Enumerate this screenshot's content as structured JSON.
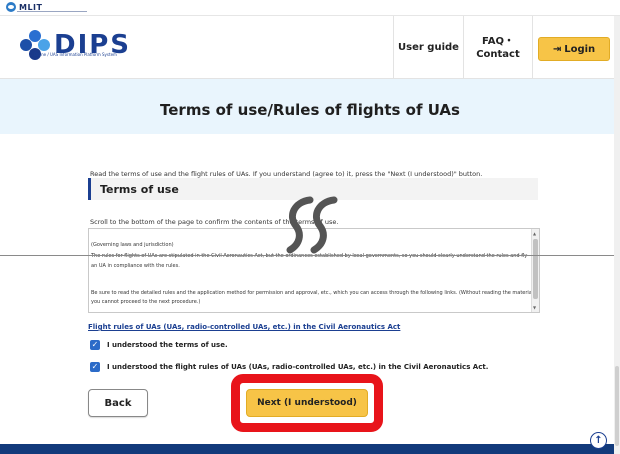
{
  "gov_bar": {
    "logo_text": "MLIT"
  },
  "header": {
    "logo_text": "DIPS",
    "logo_subtitle": "Drone / UAS Information Platform System",
    "nav": {
      "user_guide": "User guide",
      "faq_line1": "FAQ・",
      "faq_line2": "Contact",
      "login": "Login"
    }
  },
  "hero": {
    "title": "Terms of use/Rules of flights of UAs"
  },
  "content": {
    "intro": "Read the terms of use and the flight rules of UAs. If you understand (agree to) it, press the \"Next (I understood)\" button.",
    "section_title": "Terms of use",
    "scroll_note": "Scroll to the bottom of the page to confirm the contents of the terms of use.",
    "terms_lines": [
      "(Governing laws and jurisdiction)",
      "The rules for flights of UAs are stipulated in the Civil Aeronautics Act, but the ordinances established by local governments, so you should clearly understand the rules and fly",
      "an UA in compliance with the rules.",
      "Be sure to read the detailed rules and the application method for permission and approval, etc., which you can access through the following links. (Without reading the materials,",
      "you cannot proceed to the next procedure.)"
    ],
    "flight_rules_link": "Flight rules of UAs (UAs, radio-controlled UAs, etc.) in the Civil Aeronautics Act",
    "checks": [
      {
        "label": "I understood the terms of use.",
        "checked": true
      },
      {
        "label": "I understood the flight rules of UAs (UAs, radio-controlled UAs, etc.) in the Civil Aeronautics Act.",
        "checked": true
      }
    ],
    "back_label": "Back",
    "next_label": "Next (I understood)"
  },
  "icons": {
    "login": "login-icon",
    "check": "check-icon",
    "to_top": "arrow-up-icon",
    "break_marker": "page-break-icon"
  },
  "colors": {
    "accent": "#f7c447",
    "brand": "#1b3f91",
    "hero_bg": "#e9f5fd",
    "highlight": "#e8141a",
    "checkbox": "#2b6bc8",
    "footer": "#123a7b"
  }
}
